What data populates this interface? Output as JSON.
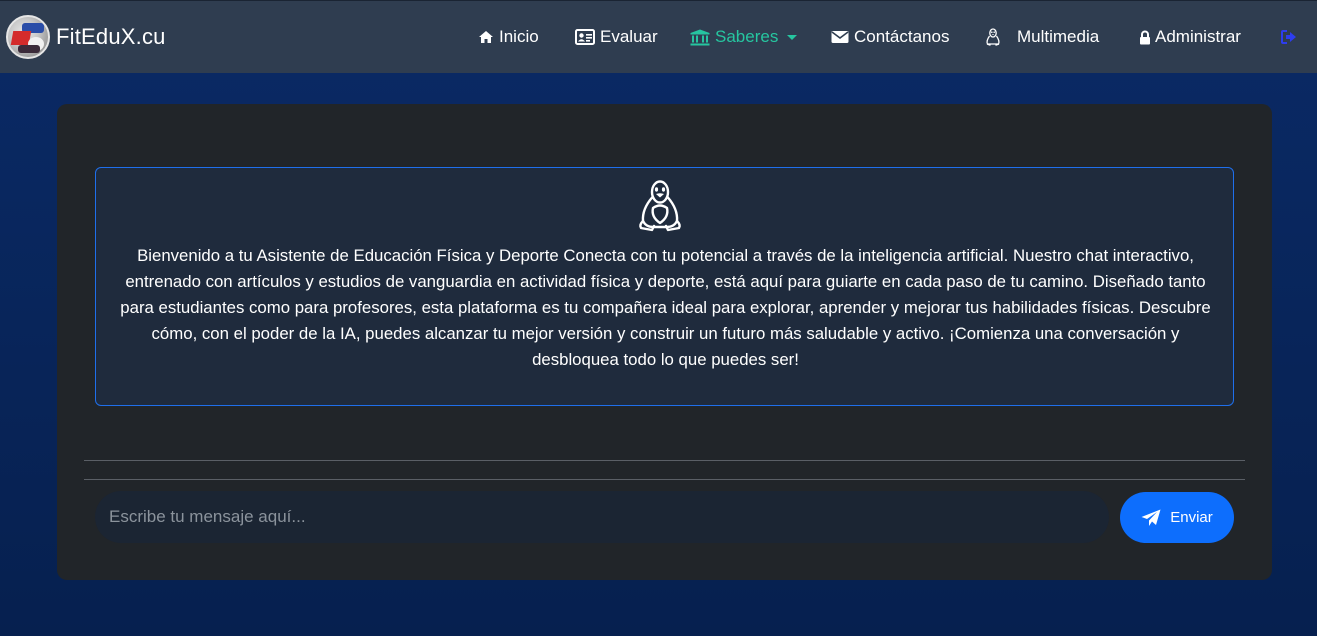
{
  "navbar": {
    "brand": "FitEduX.cu",
    "items": [
      {
        "label": "Inicio",
        "icon": "home-icon"
      },
      {
        "label": "Evaluar",
        "icon": "id-card-icon"
      },
      {
        "label": "Saberes",
        "icon": "institution-icon",
        "active": true,
        "dropdown": true
      },
      {
        "label": "Contáctanos",
        "icon": "envelope-icon"
      },
      {
        "label": "Multimedia",
        "icon": "linux-icon"
      },
      {
        "label": "Administrar",
        "icon": "lock-icon"
      }
    ],
    "logout_icon": "sign-out-icon",
    "colors": {
      "active": "#26c6a0",
      "background": "#2f3d50",
      "logout": "#2d3df0"
    }
  },
  "welcome": {
    "icon": "linux-tux-icon",
    "text": "Bienvenido a tu Asistente de Educación Física y Deporte Conecta con tu potencial a través de la inteligencia artificial. Nuestro chat interactivo, entrenado con artículos y estudios de vanguardia en actividad física y deporte, está aquí para guiarte en cada paso de tu camino. Diseñado tanto para estudiantes como para profesores, esta plataforma es tu compañera ideal para explorar, aprender y mejorar tus habilidades físicas. Descubre cómo, con el poder de la IA, puedes alcanzar tu mejor versión y construir un futuro más saludable y activo. ¡Comienza una conversación y desbloquea todo lo que puedes ser!"
  },
  "chat": {
    "input_value": "",
    "input_placeholder": "Escribe tu mensaje aquí...",
    "send_label": "Enviar",
    "send_icon": "paper-plane-icon"
  },
  "colors": {
    "send_button": "#0d6efd",
    "welcome_border": "#1f6feb",
    "card_background": "#212529",
    "page_background": "#0a2a66"
  }
}
